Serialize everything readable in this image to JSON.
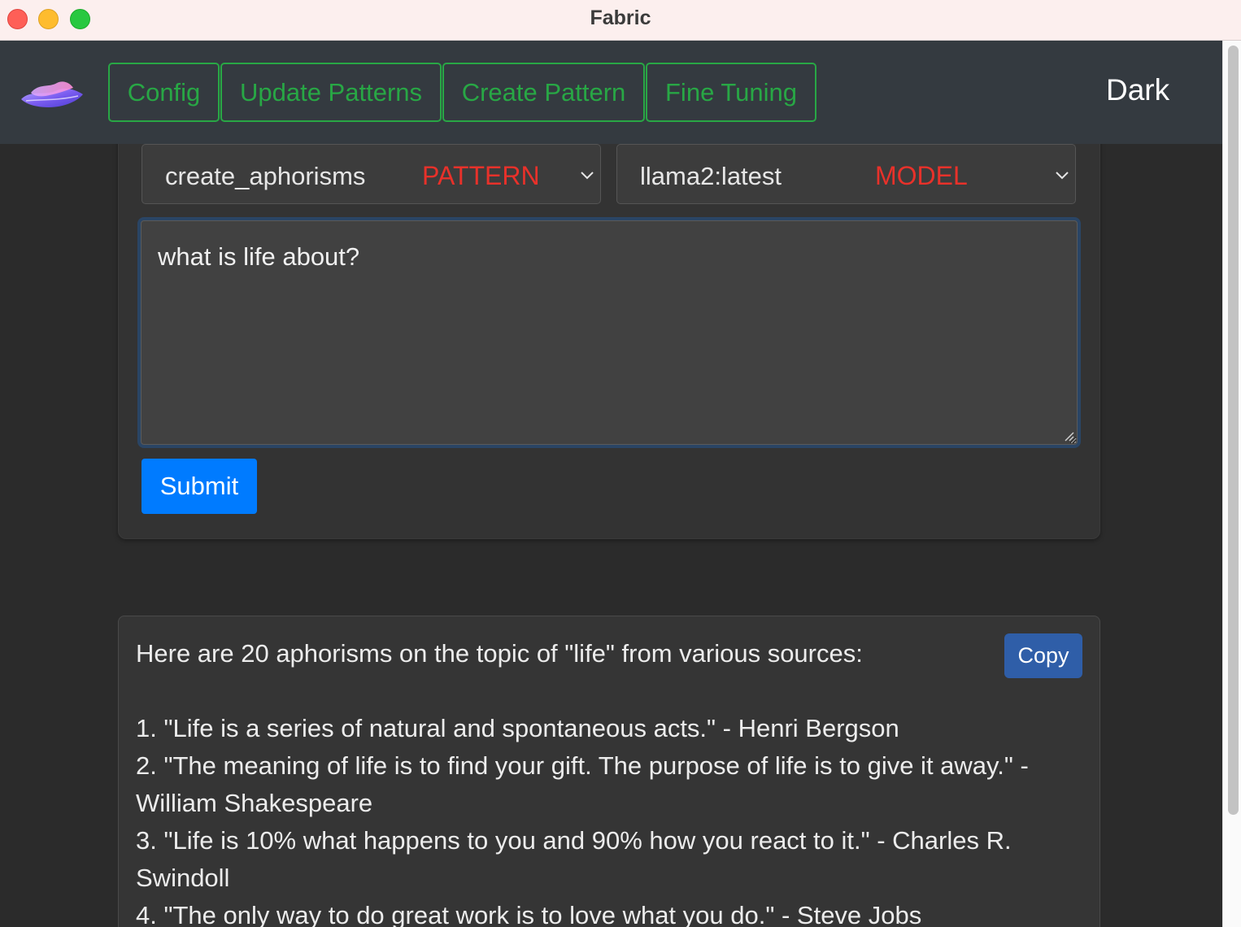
{
  "window": {
    "title": "Fabric"
  },
  "nav": {
    "buttons": [
      "Config",
      "Update Patterns",
      "Create Pattern",
      "Fine Tuning"
    ],
    "theme_label": "Dark"
  },
  "form": {
    "pattern": {
      "value": "create_aphorisms",
      "tag": "PATTERN"
    },
    "model": {
      "value": "llama2:latest",
      "tag": "MODEL"
    },
    "input_text": "what is life about?",
    "submit_label": "Submit"
  },
  "response": {
    "copy_label": "Copy",
    "intro": "Here are 20 aphorisms on the topic of \"life\" from various sources:",
    "items": [
      "1. \"Life is a series of natural and spontaneous acts.\" - Henri Bergson",
      "2. \"The meaning of life is to find your gift. The purpose of life is to give it away.\" - William Shakespeare",
      "3. \"Life is 10% what happens to you and 90% how you react to it.\" - Charles R. Swindoll",
      "4. \"The only way to do great work is to love what you do.\" - Steve Jobs"
    ]
  },
  "colors": {
    "nav_bg": "#343a40",
    "nav_button": "#28a745",
    "tag_red": "#e8312a",
    "submit_blue": "#007bff",
    "copy_blue": "#2f5ea8"
  }
}
